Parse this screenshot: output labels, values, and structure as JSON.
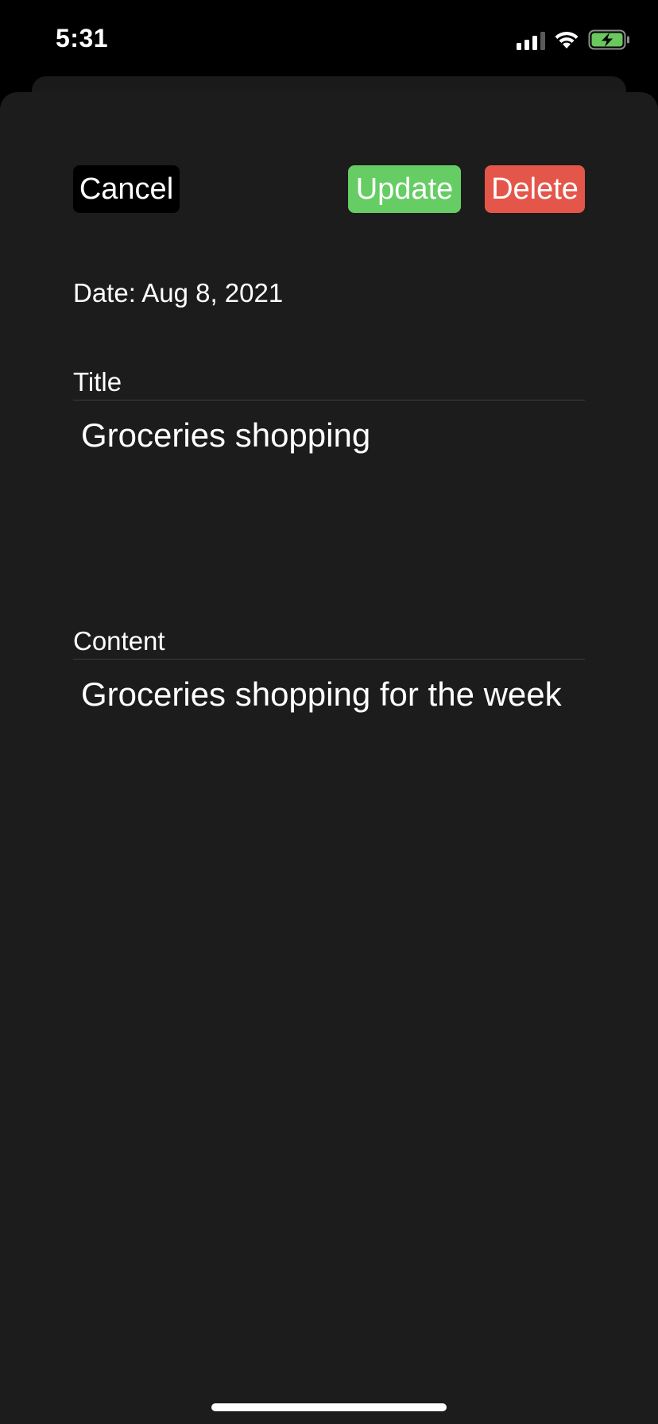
{
  "status_bar": {
    "time": "5:31",
    "icons": [
      "cellular-signal-icon",
      "wifi-icon",
      "battery-charging-icon"
    ],
    "battery_color": "#6ac85e"
  },
  "sheet": {
    "buttons": {
      "cancel": "Cancel",
      "update": "Update",
      "delete": "Delete"
    },
    "date_text": "Date: Aug 8, 2021",
    "title_field": {
      "label": "Title",
      "value": "Groceries shopping"
    },
    "content_field": {
      "label": "Content",
      "value": "Groceries shopping for the week"
    }
  },
  "colors": {
    "background": "#000000",
    "sheet": "#1c1c1c",
    "update_button": "#66cd64",
    "delete_button": "#e5564a",
    "cancel_button": "#000000"
  }
}
